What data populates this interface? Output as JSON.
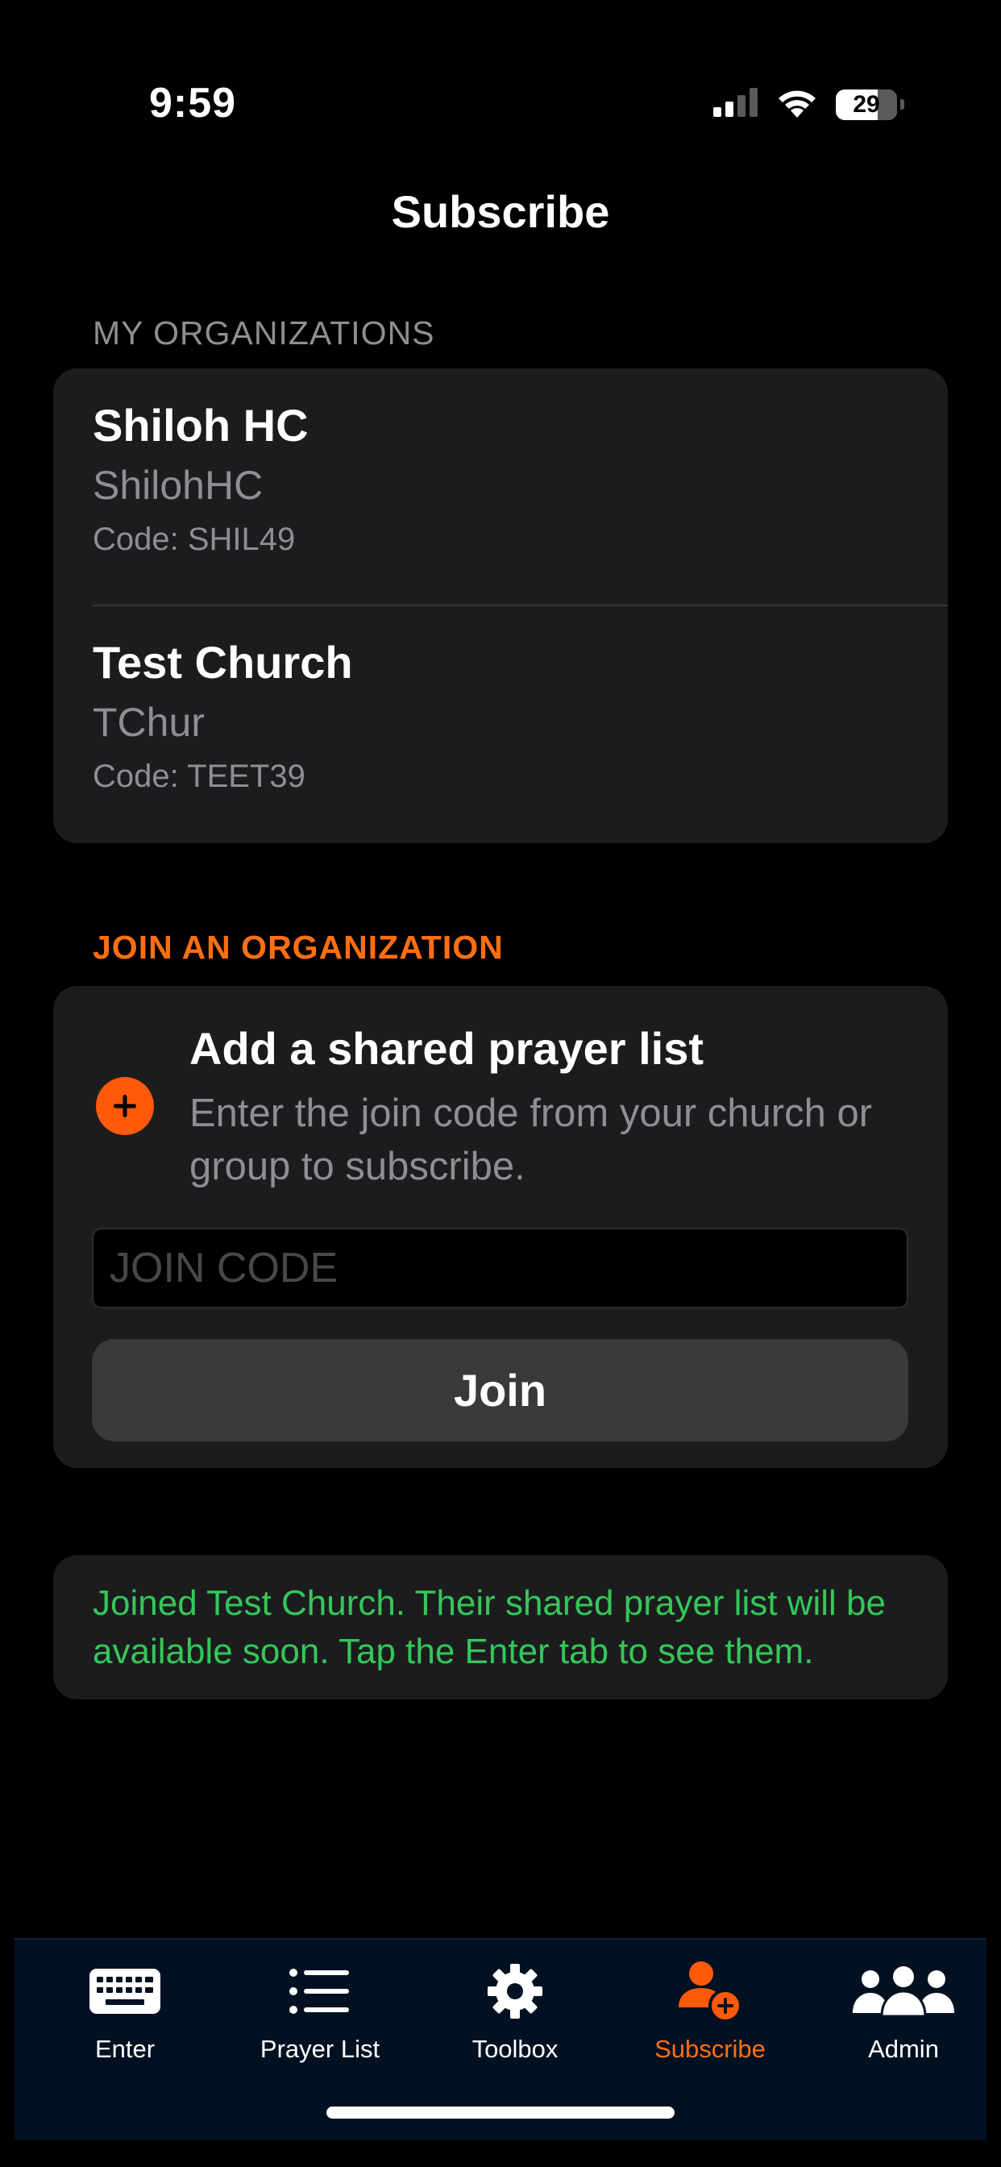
{
  "status_bar": {
    "time": "9:59",
    "battery": "29",
    "icons": [
      "cellular-signal-icon",
      "wifi-icon",
      "battery-icon"
    ]
  },
  "nav": {
    "title": "Subscribe"
  },
  "my_organizations": {
    "header": "MY ORGANIZATIONS",
    "items": [
      {
        "name": "Shiloh HC",
        "short_name": "ShilohHC",
        "code": "Code: SHIL49"
      },
      {
        "name": "Test Church",
        "short_name": "TChur",
        "code": "Code: TEET39"
      }
    ]
  },
  "join": {
    "header": "JOIN AN ORGANIZATION",
    "icon": "plus-circle-icon",
    "title": "Add a shared prayer list",
    "description": "Enter the join code from your church or group to subscribe.",
    "input_value": "",
    "input_placeholder": "JOIN CODE",
    "button_label": "Join"
  },
  "message": {
    "text": "Joined Test Church. Their shared prayer list will be available soon. Tap the Enter tab to see them."
  },
  "tab_bar": {
    "tabs": [
      {
        "label": "Enter",
        "icon": "keyboard-icon",
        "active": false
      },
      {
        "label": "Prayer List",
        "icon": "list-icon",
        "active": false
      },
      {
        "label": "Toolbox",
        "icon": "gear-icon",
        "active": false
      },
      {
        "label": "Subscribe",
        "icon": "person-add-icon",
        "active": true
      },
      {
        "label": "Admin",
        "icon": "people-icon",
        "active": false
      }
    ]
  },
  "colors": {
    "background": "#000000",
    "card": "#1c1c1e",
    "accent": "#ff6f12",
    "secondary_text": "#8e8e93",
    "success": "#34c759",
    "tab_bar": "#021121",
    "button": "#3a3a3c"
  }
}
